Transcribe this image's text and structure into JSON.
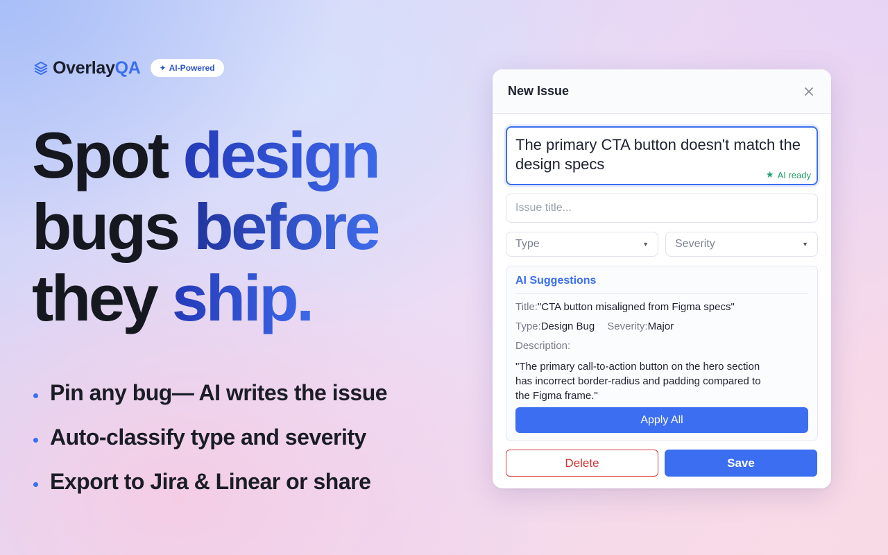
{
  "brand": {
    "name_primary": "Overlay",
    "name_accent": "QA",
    "badge_star": "✦",
    "badge": "AI-Powered",
    "icon": "layers-icon"
  },
  "headline": {
    "line1_plain": "Spot ",
    "line1_highlight": "design",
    "line2_plain": "bugs ",
    "line2_highlight": "before",
    "line3_plain": "they ",
    "line3_highlight": "ship."
  },
  "bullets": [
    "Pin any bug— AI writes the issue",
    "Auto-classify type and severity",
    "Export to Jira & Linear or share"
  ],
  "modal": {
    "title": "New Issue",
    "close_icon": "close-icon",
    "description_value": "The primary CTA button doesn't match the design specs",
    "ai_ready_star": "★",
    "ai_ready": "AI ready",
    "title_placeholder": "Issue title...",
    "type_placeholder": "Type",
    "severity_placeholder": "Severity",
    "suggestions": {
      "heading": "AI Suggestions",
      "title_label": "Title:",
      "title_value": "\"CTA button misaligned from Figma specs\"",
      "type_label": "Type:",
      "type_value": "Design Bug",
      "severity_label": "Severity:",
      "severity_value": "Major",
      "description_label": "Description:",
      "description_value": "\"The primary call-to-action button on the hero section has incorrect border-radius and padding compared to the Figma frame.\"",
      "apply_label": "Apply All"
    },
    "delete_label": "Delete",
    "save_label": "Save"
  },
  "colors": {
    "accent": "#3b6ef0",
    "danger": "#d13434",
    "success": "#22a06b"
  }
}
